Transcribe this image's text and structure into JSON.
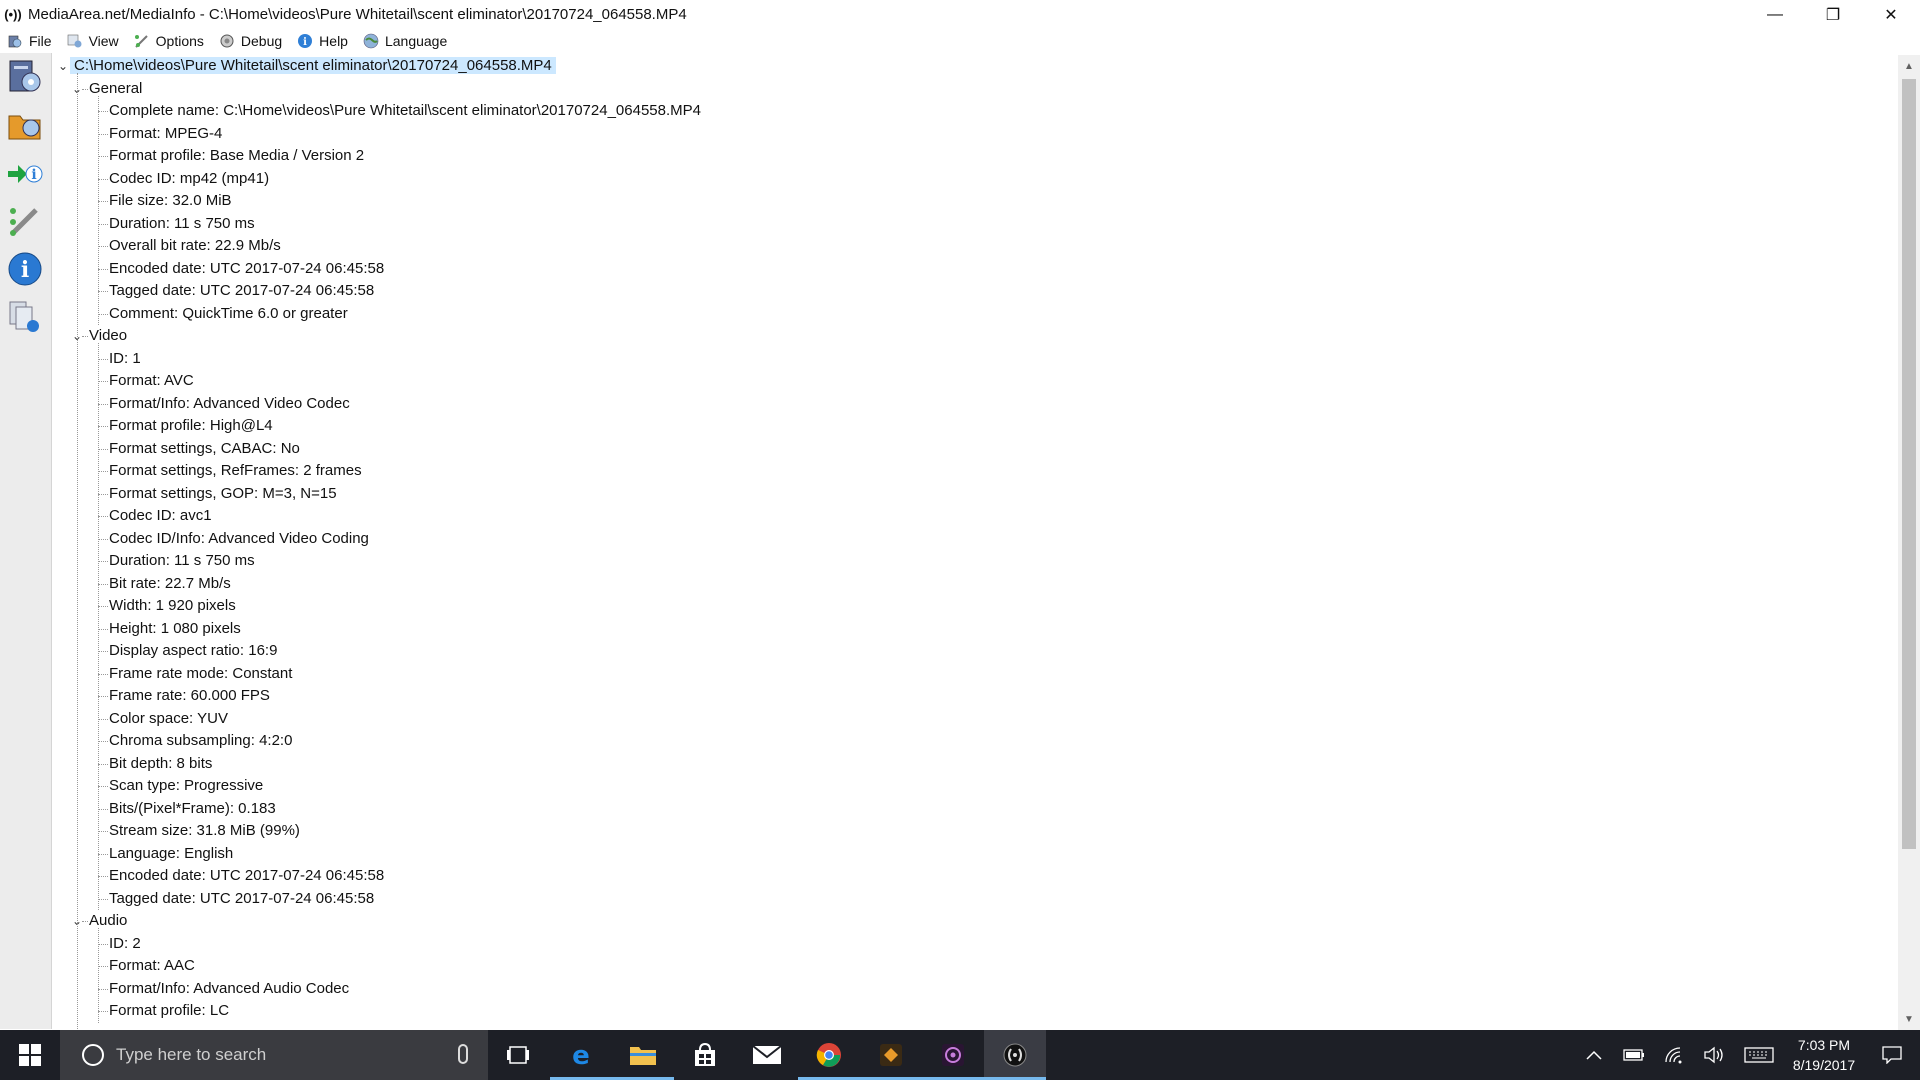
{
  "window": {
    "icon_glyph": "(•))",
    "title": "MediaArea.net/MediaInfo - C:\\Home\\videos\\Pure Whitetail\\scent eliminator\\20170724_064558.MP4",
    "minimize_glyph": "—",
    "maximize_glyph": "❐",
    "close_glyph": "✕"
  },
  "menu": [
    {
      "label": "File",
      "icon": "file-open-icon"
    },
    {
      "label": "View",
      "icon": "view-icon"
    },
    {
      "label": "Options",
      "icon": "options-icon"
    },
    {
      "label": "Debug",
      "icon": "debug-icon"
    },
    {
      "label": "Help",
      "icon": "help-icon"
    },
    {
      "label": "Language",
      "icon": "language-icon"
    }
  ],
  "toolbar": [
    {
      "icon": "open-file-icon"
    },
    {
      "icon": "open-folder-icon"
    },
    {
      "icon": "export-icon"
    },
    {
      "icon": "preferences-icon"
    },
    {
      "icon": "about-icon"
    },
    {
      "icon": "knowledge-base-icon"
    }
  ],
  "tree": {
    "root": "C:\\Home\\videos\\Pure Whitetail\\scent eliminator\\20170724_064558.MP4",
    "sections": [
      {
        "name": "General",
        "items": [
          "Complete name: C:\\Home\\videos\\Pure Whitetail\\scent eliminator\\20170724_064558.MP4",
          "Format: MPEG-4",
          "Format profile: Base Media / Version 2",
          "Codec ID: mp42 (mp41)",
          "File size: 32.0 MiB",
          "Duration: 11 s 750 ms",
          "Overall bit rate: 22.9 Mb/s",
          "Encoded date: UTC 2017-07-24 06:45:58",
          "Tagged date: UTC 2017-07-24 06:45:58",
          "Comment: QuickTime 6.0 or greater"
        ]
      },
      {
        "name": "Video",
        "items": [
          "ID: 1",
          "Format: AVC",
          "Format/Info: Advanced Video Codec",
          "Format profile: High@L4",
          "Format settings, CABAC: No",
          "Format settings, RefFrames: 2 frames",
          "Format settings, GOP: M=3, N=15",
          "Codec ID: avc1",
          "Codec ID/Info: Advanced Video Coding",
          "Duration: 11 s 750 ms",
          "Bit rate: 22.7 Mb/s",
          "Width: 1 920 pixels",
          "Height: 1 080 pixels",
          "Display aspect ratio: 16:9",
          "Frame rate mode: Constant",
          "Frame rate: 60.000 FPS",
          "Color space: YUV",
          "Chroma subsampling: 4:2:0",
          "Bit depth: 8 bits",
          "Scan type: Progressive",
          "Bits/(Pixel*Frame): 0.183",
          "Stream size: 31.8 MiB (99%)",
          "Language: English",
          "Encoded date: UTC 2017-07-24 06:45:58",
          "Tagged date: UTC 2017-07-24 06:45:58"
        ]
      },
      {
        "name": "Audio",
        "items": [
          "ID: 2",
          "Format: AAC",
          "Format/Info: Advanced Audio Codec",
          "Format profile: LC"
        ]
      }
    ]
  },
  "taskbar": {
    "search_placeholder": "Type here to search",
    "apps": [
      {
        "icon": "task-view-icon"
      },
      {
        "icon": "edge-icon"
      },
      {
        "icon": "file-explorer-icon"
      },
      {
        "icon": "store-icon"
      },
      {
        "icon": "mail-icon"
      },
      {
        "icon": "chrome-icon"
      },
      {
        "icon": "media-app-icon"
      },
      {
        "icon": "video-editor-icon"
      },
      {
        "icon": "mediainfo-icon"
      }
    ],
    "time": "7:03 PM",
    "date": "8/19/2017"
  },
  "colors": {
    "selection": "#cce8ff",
    "taskbar": "#1d1f26",
    "accent": "#76b9ed"
  }
}
